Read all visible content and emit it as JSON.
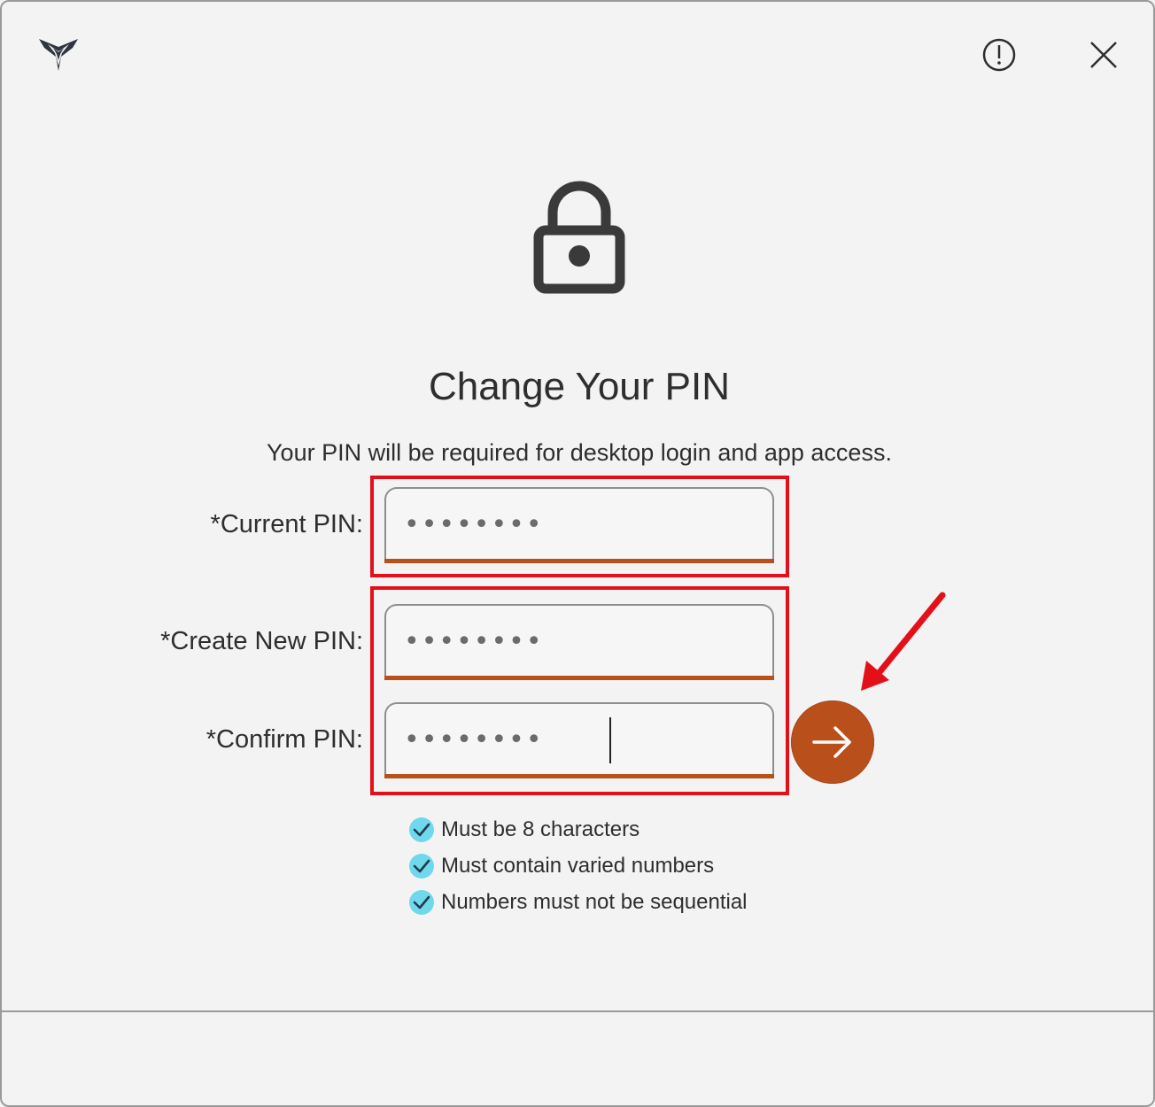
{
  "header": {
    "logo_icon": "app-logo-icon",
    "info_icon": "exclamation-circle-icon",
    "close_icon": "close-icon"
  },
  "main": {
    "lock_icon": "lock-icon",
    "title": "Change Your PIN",
    "subtitle": "Your PIN will be required for desktop login and app access."
  },
  "form": {
    "current_label": "*Current PIN:",
    "current_value": "••••••••",
    "new_label": "*Create New PIN:",
    "new_value": "••••••••",
    "confirm_label": "*Confirm PIN:",
    "confirm_value": "••••••••",
    "submit_icon": "arrow-right-icon"
  },
  "requirements": [
    {
      "text": "Must be 8 characters",
      "met": true
    },
    {
      "text": "Must contain varied numbers",
      "met": true
    },
    {
      "text": "Numbers must not be sequential",
      "met": true
    }
  ],
  "colors": {
    "accent": "#b9501c",
    "highlight": "#e3101a",
    "check": "#6fd8ec"
  }
}
